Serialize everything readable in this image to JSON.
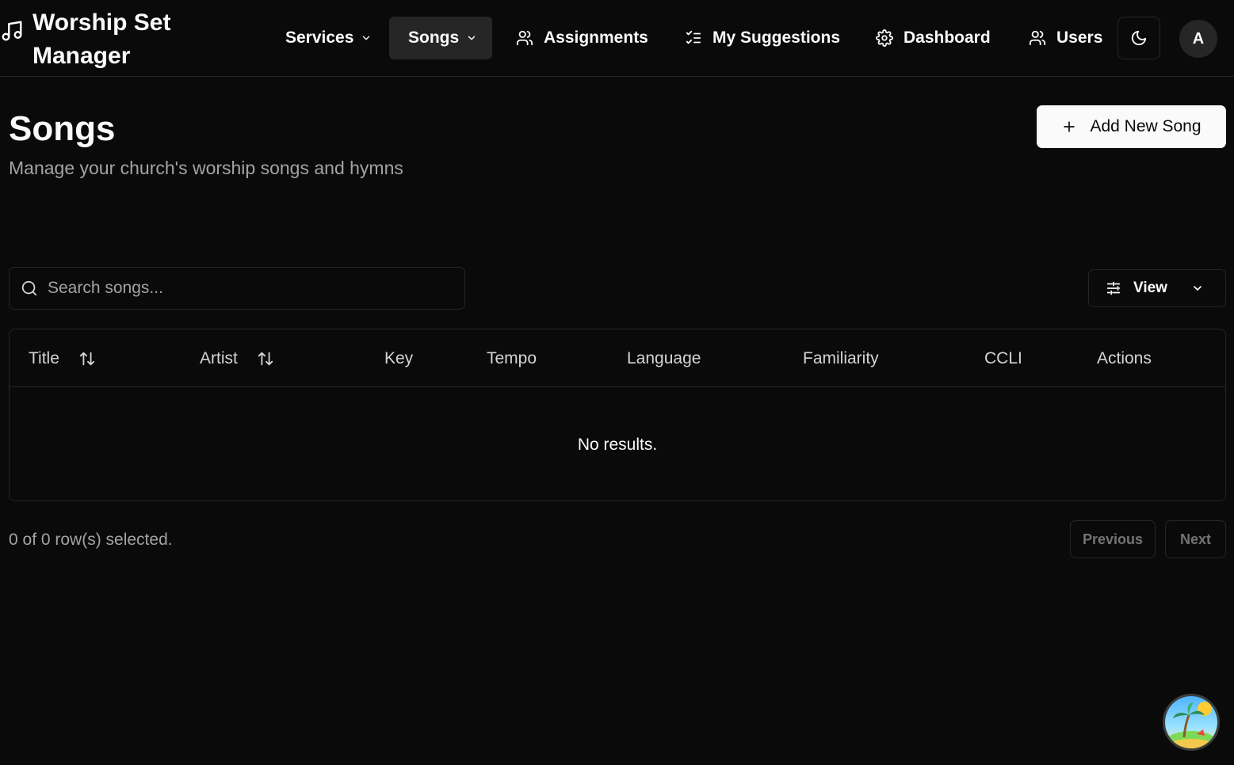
{
  "app": {
    "title": "Worship Set Manager"
  },
  "nav": {
    "services": "Services",
    "songs": "Songs",
    "assignments": "Assignments",
    "suggestions": "My Suggestions",
    "dashboard": "Dashboard",
    "users": "Users"
  },
  "user": {
    "avatar_initial": "A"
  },
  "page": {
    "title": "Songs",
    "subtitle": "Manage your church's worship songs and hymns",
    "add_button": "Add New Song"
  },
  "search": {
    "placeholder": "Search songs..."
  },
  "view_button": "View",
  "table": {
    "columns": [
      "Title",
      "Artist",
      "Key",
      "Tempo",
      "Language",
      "Familiarity",
      "CCLI",
      "Actions"
    ],
    "empty_message": "No results."
  },
  "footer": {
    "selected": "0 of 0 row(s) selected.",
    "previous": "Previous",
    "next": "Next"
  },
  "colors": {
    "background": "#0a0a0a",
    "border": "#262626",
    "foreground": "#fafafa",
    "muted": "#a3a3a3"
  }
}
